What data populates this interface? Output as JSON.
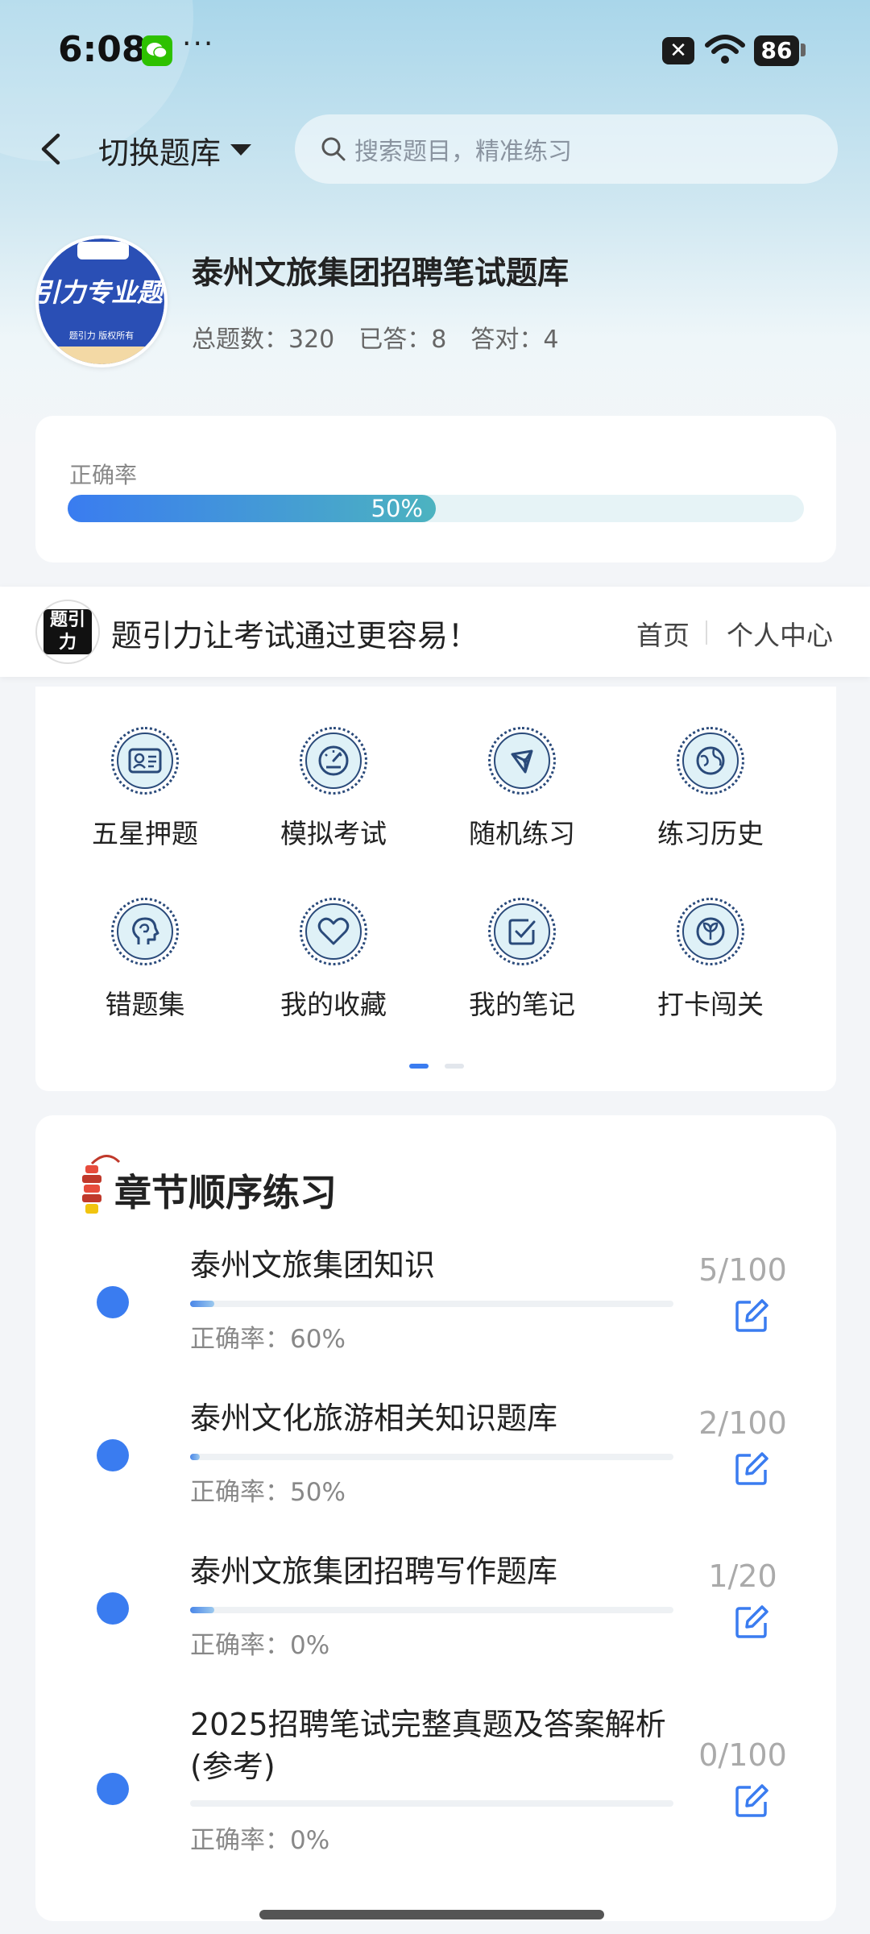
{
  "status_bar": {
    "time": "6:08",
    "dots": "···",
    "mute_glyph": "✕",
    "battery": "86"
  },
  "header": {
    "switch_label": "切换题库",
    "search_placeholder": "搜索题目，精准练习"
  },
  "bank": {
    "logo_text": "引力专业题",
    "logo_subtext": "题引力 版权所有",
    "title": "泰州文旅集团招聘笔试题库",
    "stats": {
      "total": "总题数：320",
      "answered": "已答：8",
      "correct": "答对：4"
    }
  },
  "accuracy": {
    "label": "正确率",
    "value_text": "50%",
    "fraction": 0.5
  },
  "promo": {
    "logo_text": "题引力",
    "text": "题引力让考试通过更容易！",
    "home": "首页",
    "me": "个人中心"
  },
  "features": [
    {
      "label": "五星押题",
      "icon": "id-card-icon"
    },
    {
      "label": "模拟考试",
      "icon": "gauge-icon"
    },
    {
      "label": "随机练习",
      "icon": "network-icon"
    },
    {
      "label": "练习历史",
      "icon": "globe-icon"
    },
    {
      "label": "错题集",
      "icon": "head-icon"
    },
    {
      "label": "我的收藏",
      "icon": "heart-icon"
    },
    {
      "label": "我的笔记",
      "icon": "checkbox-icon"
    },
    {
      "label": "打卡闯关",
      "icon": "sprout-icon"
    }
  ],
  "chapters": {
    "title": "章节顺序练习",
    "items": [
      {
        "name": "泰州文旅集团知识",
        "accuracy": "正确率：60%",
        "count": "5/100",
        "progress": 0.05
      },
      {
        "name": "泰州文化旅游相关知识题库",
        "accuracy": "正确率：50%",
        "count": "2/100",
        "progress": 0.02
      },
      {
        "name": "泰州文旅集团招聘写作题库",
        "accuracy": "正确率：0%",
        "count": "1/20",
        "progress": 0.05
      },
      {
        "name": "2025招聘笔试完整真题及答案解析(参考)",
        "accuracy": "正确率：0%",
        "count": "0/100",
        "progress": 0
      }
    ]
  },
  "colors": {
    "accent": "#3a7cf0",
    "teal": "#4cb3c0",
    "icon_stroke": "#2a4a7a"
  }
}
